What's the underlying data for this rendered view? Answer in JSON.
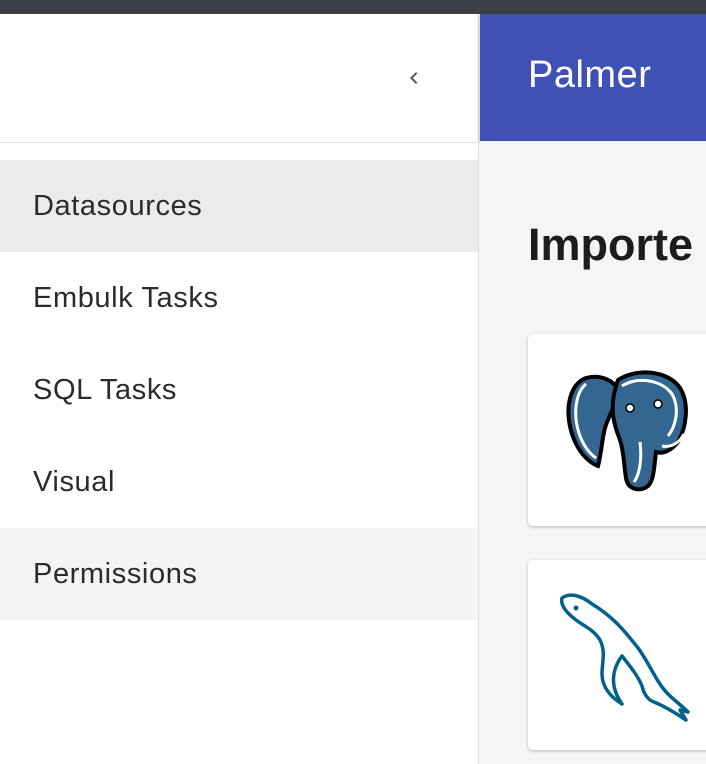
{
  "app": {
    "title": "Palmer"
  },
  "drawer": {
    "collapse_icon": "chevron-left-icon",
    "items": [
      {
        "label": "Datasources",
        "state": "selected"
      },
      {
        "label": "Embulk Tasks",
        "state": "normal"
      },
      {
        "label": "SQL Tasks",
        "state": "normal"
      },
      {
        "label": "Visual",
        "state": "normal"
      },
      {
        "label": "Permissions",
        "state": "hover"
      }
    ]
  },
  "main": {
    "heading": "Importe",
    "cards": [
      {
        "logo": "postgresql-elephant-icon"
      },
      {
        "logo": "mysql-dolphin-icon"
      }
    ]
  },
  "colors": {
    "appbar": "#3f51b5",
    "selected_item": "#ebebeb",
    "postgres_blue": "#336791",
    "mysql_blue": "#00618a"
  }
}
